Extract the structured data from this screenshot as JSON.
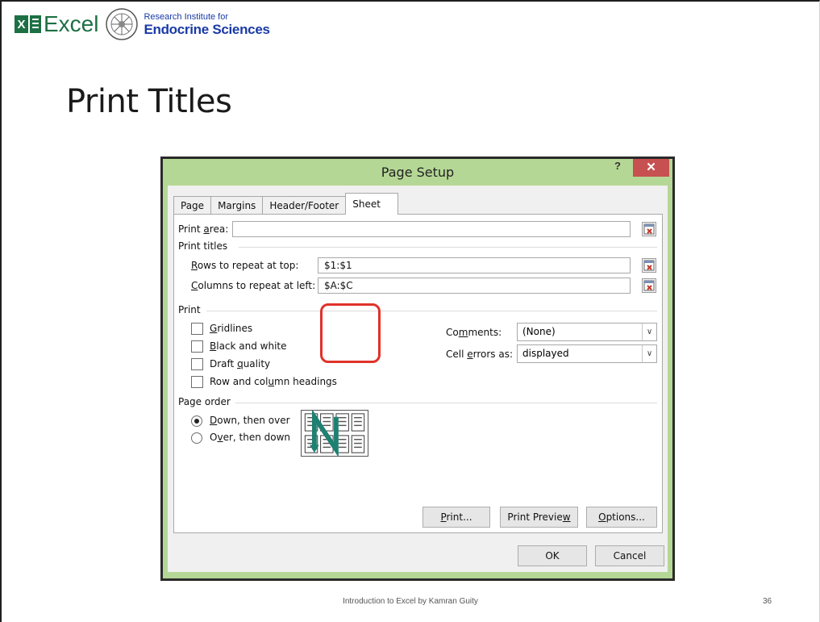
{
  "header": {
    "excel_word": "Excel",
    "institute_line1": "Research Institute for",
    "institute_line2": "Endocrine Sciences"
  },
  "slide_title": "Print Titles",
  "dialog": {
    "title": "Page Setup",
    "help": "?",
    "close": "✕",
    "tabs": [
      "Page",
      "Margins",
      "Header/Footer",
      "Sheet"
    ],
    "active_tab": "Sheet",
    "print_area_label_pre": "Print ",
    "print_area_label_u": "a",
    "print_area_label_post": "rea:",
    "print_area_value": "",
    "print_titles_heading": "Print titles",
    "rows_label_u": "R",
    "rows_label_post": "ows to repeat at top:",
    "rows_value": "$1:$1",
    "cols_label_u": "C",
    "cols_label_post": "olumns to repeat at left:",
    "cols_value": "$A:$C",
    "print_heading": "Print",
    "gridlines_u": "G",
    "gridlines_post": "ridlines",
    "bw_u": "B",
    "bw_post": "lack and white",
    "draft_pre": "Draft ",
    "draft_u": "q",
    "draft_post": "uality",
    "rowcol_pre": "Row and col",
    "rowcol_u": "u",
    "rowcol_post": "mn headings",
    "comments_pre": "Co",
    "comments_u": "m",
    "comments_post": "ments:",
    "comments_value": "(None)",
    "cellerr_pre": "Cell ",
    "cellerr_u": "e",
    "cellerr_post": "rrors as:",
    "cellerr_value": "displayed",
    "page_order_heading": "Page order",
    "down_u": "D",
    "down_post": "own, then over",
    "over_pre": "O",
    "over_u": "v",
    "over_post": "er, then down",
    "page_order_selected": "down_then_over",
    "btn_print_u": "P",
    "btn_print_post": "rint...",
    "btn_preview_pre": "Print Previe",
    "btn_preview_u": "w",
    "btn_options_u": "O",
    "btn_options_post": "ptions...",
    "btn_ok": "OK",
    "btn_cancel": "Cancel"
  },
  "footer": {
    "caption": "Introduction to Excel by Kamran Guity",
    "page_number": "36"
  },
  "colors": {
    "dialog_frame": "#b5d795",
    "close_button": "#c75050",
    "highlight": "#e0322a",
    "excel_green": "#1d7044",
    "institute_blue": "#1a3aa6"
  }
}
